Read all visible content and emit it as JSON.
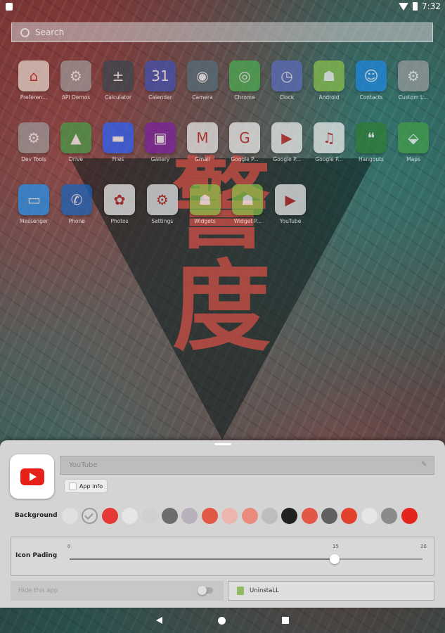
{
  "status_bar": {
    "time": "7:32"
  },
  "search": {
    "placeholder": "Search"
  },
  "apps": [
    [
      {
        "label": "Preferen...",
        "icon": "preferences-icon",
        "color": "#e8dcd0",
        "glyph": "⌂"
      },
      {
        "label": "API Demos",
        "icon": "api-demos-icon",
        "color": "#9e9e9e",
        "glyph": "⚙"
      },
      {
        "label": "Calculator",
        "icon": "calculator-icon",
        "color": "#37474f",
        "glyph": "±"
      },
      {
        "label": "Calendar",
        "icon": "calendar-icon",
        "color": "#3f51b5",
        "glyph": "31"
      },
      {
        "label": "Camera",
        "icon": "camera-icon",
        "color": "#546e7a",
        "glyph": "◉"
      },
      {
        "label": "Chrome",
        "icon": "chrome-icon",
        "color": "#4caf50",
        "glyph": "◎"
      },
      {
        "label": "Clock",
        "icon": "clock-icon",
        "color": "#5c6bc0",
        "glyph": "◷"
      },
      {
        "label": "Android",
        "icon": "android-icon",
        "color": "#8bc34a",
        "glyph": "☗"
      },
      {
        "label": "Contacts",
        "icon": "contacts-icon",
        "color": "#1e88e5",
        "glyph": "☺"
      },
      {
        "label": "Custom L...",
        "icon": "custom-locale-icon",
        "color": "#9e9e9e",
        "glyph": "⚙"
      }
    ],
    [
      {
        "label": "Dev Tools",
        "icon": "dev-tools-icon",
        "color": "#9e9e9e",
        "glyph": "⚙"
      },
      {
        "label": "Drive",
        "icon": "drive-icon",
        "color": "#43a047",
        "glyph": "▲"
      },
      {
        "label": "Files",
        "icon": "files-icon",
        "color": "#2962ff",
        "glyph": "▬"
      },
      {
        "label": "Gallery",
        "icon": "gallery-icon",
        "color": "#7b1fa2",
        "glyph": "▣"
      },
      {
        "label": "Gmail",
        "icon": "gmail-icon",
        "color": "#eeeeee",
        "glyph": "M"
      },
      {
        "label": "Google P...",
        "icon": "google-icon",
        "color": "#f5f5f5",
        "glyph": "G"
      },
      {
        "label": "Google P...",
        "icon": "play-movies-icon",
        "color": "#f5f5f5",
        "glyph": "▶"
      },
      {
        "label": "Google P...",
        "icon": "play-music-icon",
        "color": "#f5f5f5",
        "glyph": "♫"
      },
      {
        "label": "Hangouts",
        "icon": "hangouts-icon",
        "color": "#2e7d32",
        "glyph": "❝"
      },
      {
        "label": "Maps",
        "icon": "maps-icon",
        "color": "#43a047",
        "glyph": "⬙"
      }
    ],
    [
      {
        "label": "Messenger",
        "icon": "messenger-icon",
        "color": "#2196f3",
        "glyph": "▭"
      },
      {
        "label": "Phone",
        "icon": "phone-icon",
        "color": "#1565c0",
        "glyph": "✆"
      },
      {
        "label": "Photos",
        "icon": "photos-icon",
        "color": "#f5f5f5",
        "glyph": "✿"
      },
      {
        "label": "Settings",
        "icon": "settings-icon",
        "color": "#eceff1",
        "glyph": "⚙"
      },
      {
        "label": "Widgets",
        "icon": "widgets-icon",
        "color": "#8bc34a",
        "glyph": "☗"
      },
      {
        "label": "Widget P...",
        "icon": "widget-preview-icon",
        "color": "#8bc34a",
        "glyph": "☗"
      },
      {
        "label": "YouTube",
        "icon": "youtube-icon",
        "color": "#f5f5f5",
        "glyph": "▶"
      }
    ]
  ],
  "sheet": {
    "app_name": "YouTube",
    "app_info_label": "App info",
    "background_label": "Background",
    "swatches": [
      "#e0e0e0",
      "#d8d8d8",
      "#e53935",
      "#e6e6e6",
      "#d0d0d0",
      "#6d6d6d",
      "#b8b0bb",
      "#e25745",
      "#eab6ad",
      "#e98a7c",
      "#bdbdbd",
      "#212121",
      "#e25745",
      "#616161",
      "#e2422d",
      "#e6e6e6",
      "#8a8a8a",
      "#e2261b"
    ],
    "selected_swatch_index": 1,
    "icon_padding_label": "Icon Pading",
    "slider": {
      "min": "0",
      "mid": "15",
      "max": "20",
      "value": 15
    },
    "hide_label": "Hide this app",
    "hide_enabled": false,
    "uninstall_label": "UninstaLL"
  }
}
